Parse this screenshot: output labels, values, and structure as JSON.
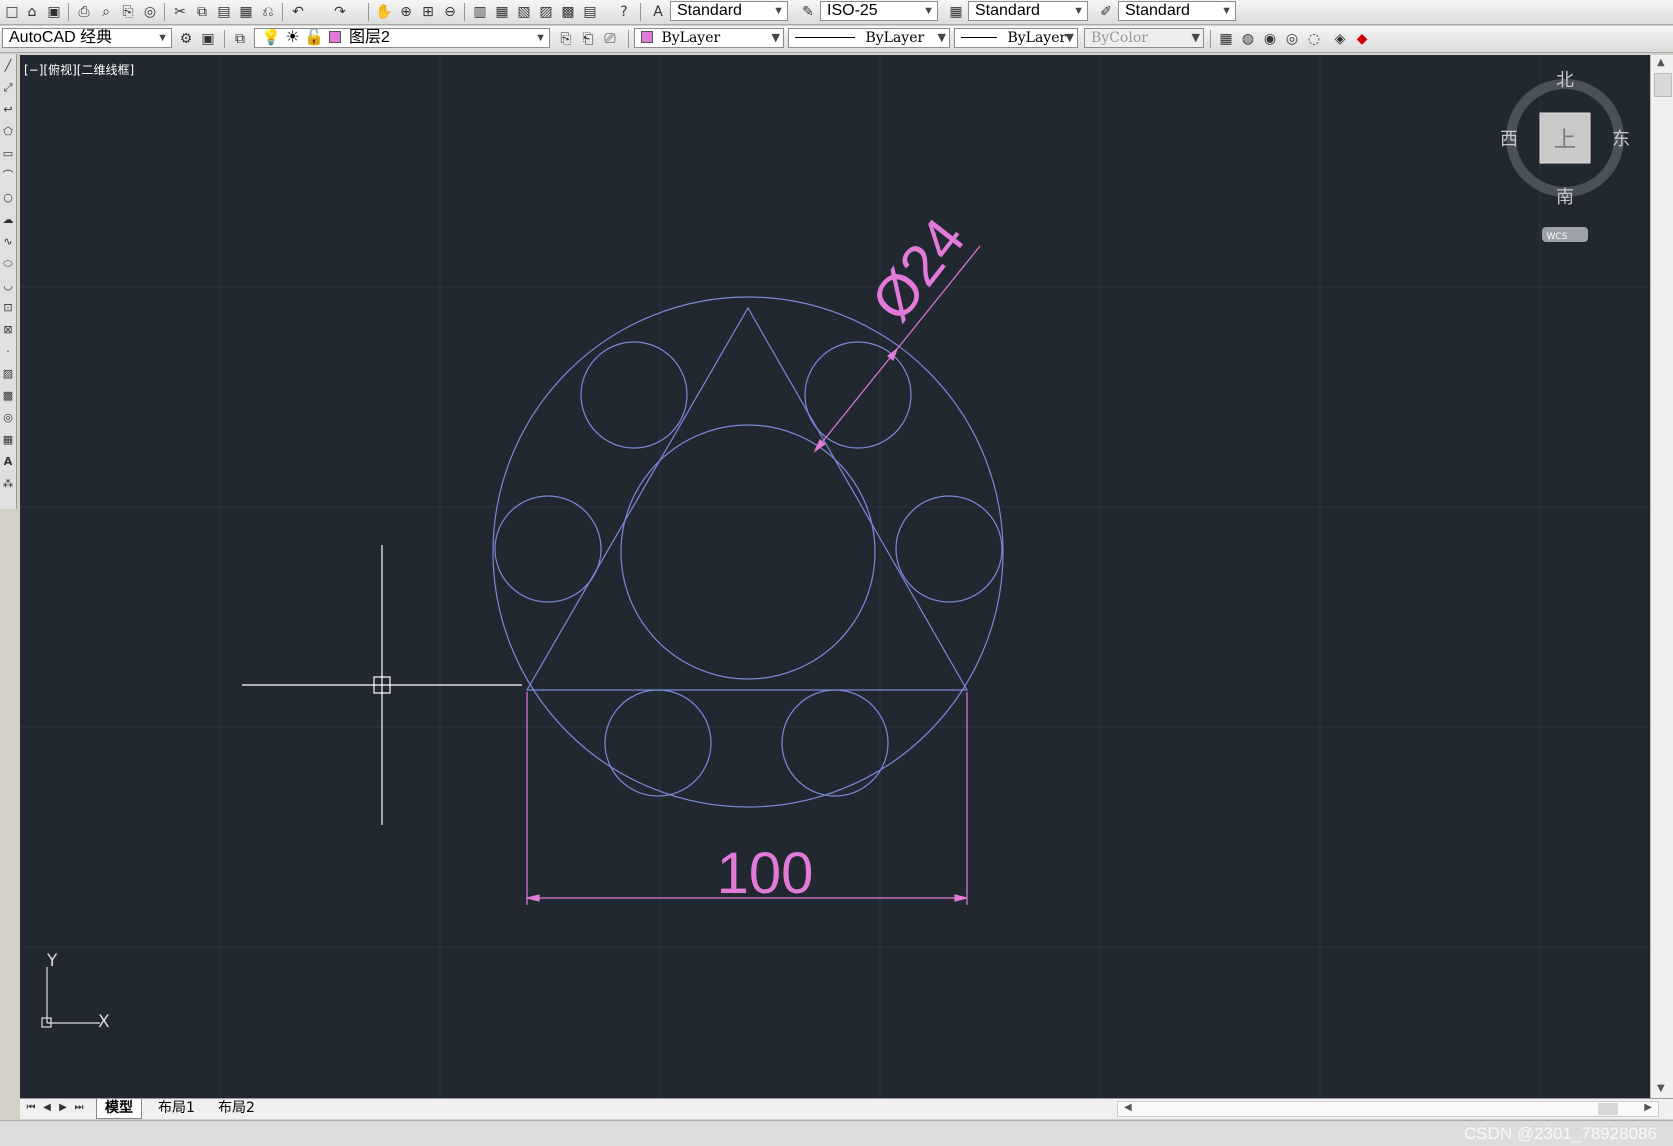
{
  "toolbar1": {
    "text_style": "Standard",
    "dim_style": "ISO-25",
    "table_style": "Standard",
    "multileader_style": "Standard"
  },
  "toolbar2": {
    "workspace": "AutoCAD 经典",
    "layer": "图层2",
    "color": "ByLayer",
    "linetype": "ByLayer",
    "lineweight": "ByLayer",
    "plotstyle": "ByColor"
  },
  "viewport": {
    "label": "[−][俯视][二维线框]"
  },
  "viewcube": {
    "north": "北",
    "south": "南",
    "east": "东",
    "west": "西",
    "top_face": "上",
    "wcs": "WCS"
  },
  "drawing": {
    "diameter_dim": "Ø24",
    "linear_dim": "100"
  },
  "ucs": {
    "x_label": "X",
    "y_label": "Y"
  },
  "tabs": [
    "模型",
    "布局1",
    "布局2"
  ],
  "watermark": "CSDN @2301_78928086",
  "colors": {
    "background": "#212830",
    "geometry": "#7b89d9",
    "dimension": "#e27ad9",
    "crosshair": "#ffffff"
  }
}
